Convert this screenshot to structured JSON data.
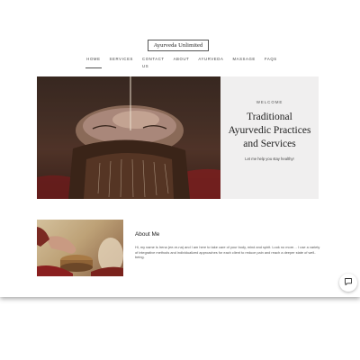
{
  "site": {
    "logo": "Ayurveda Unlimited"
  },
  "nav": {
    "items": [
      "HOME",
      "SERVICES",
      "CONTACT US",
      "ABOUT",
      "AYURVEDA",
      "MASSAGE",
      "FAQS"
    ],
    "active": "HOME"
  },
  "hero": {
    "welcome": "WELCOME",
    "title": "Traditional Ayurvedic Practices and Services",
    "subtitle": "Let me help you stay healthy!"
  },
  "about": {
    "title": "About Me",
    "text": "Hi, my name is Irena (ee-re-na) and I am here to take care of your body, mind and spirit. Look no more… I use a variety of integrative methods and individualized approaches for each client to reduce pain and reach a deeper state of well-being."
  },
  "chat": {
    "icon": "chat-bubble-icon"
  },
  "colors": {
    "panel_bg": "#f0efef",
    "text_dark": "#222222",
    "page_bg": "#ffffff"
  }
}
